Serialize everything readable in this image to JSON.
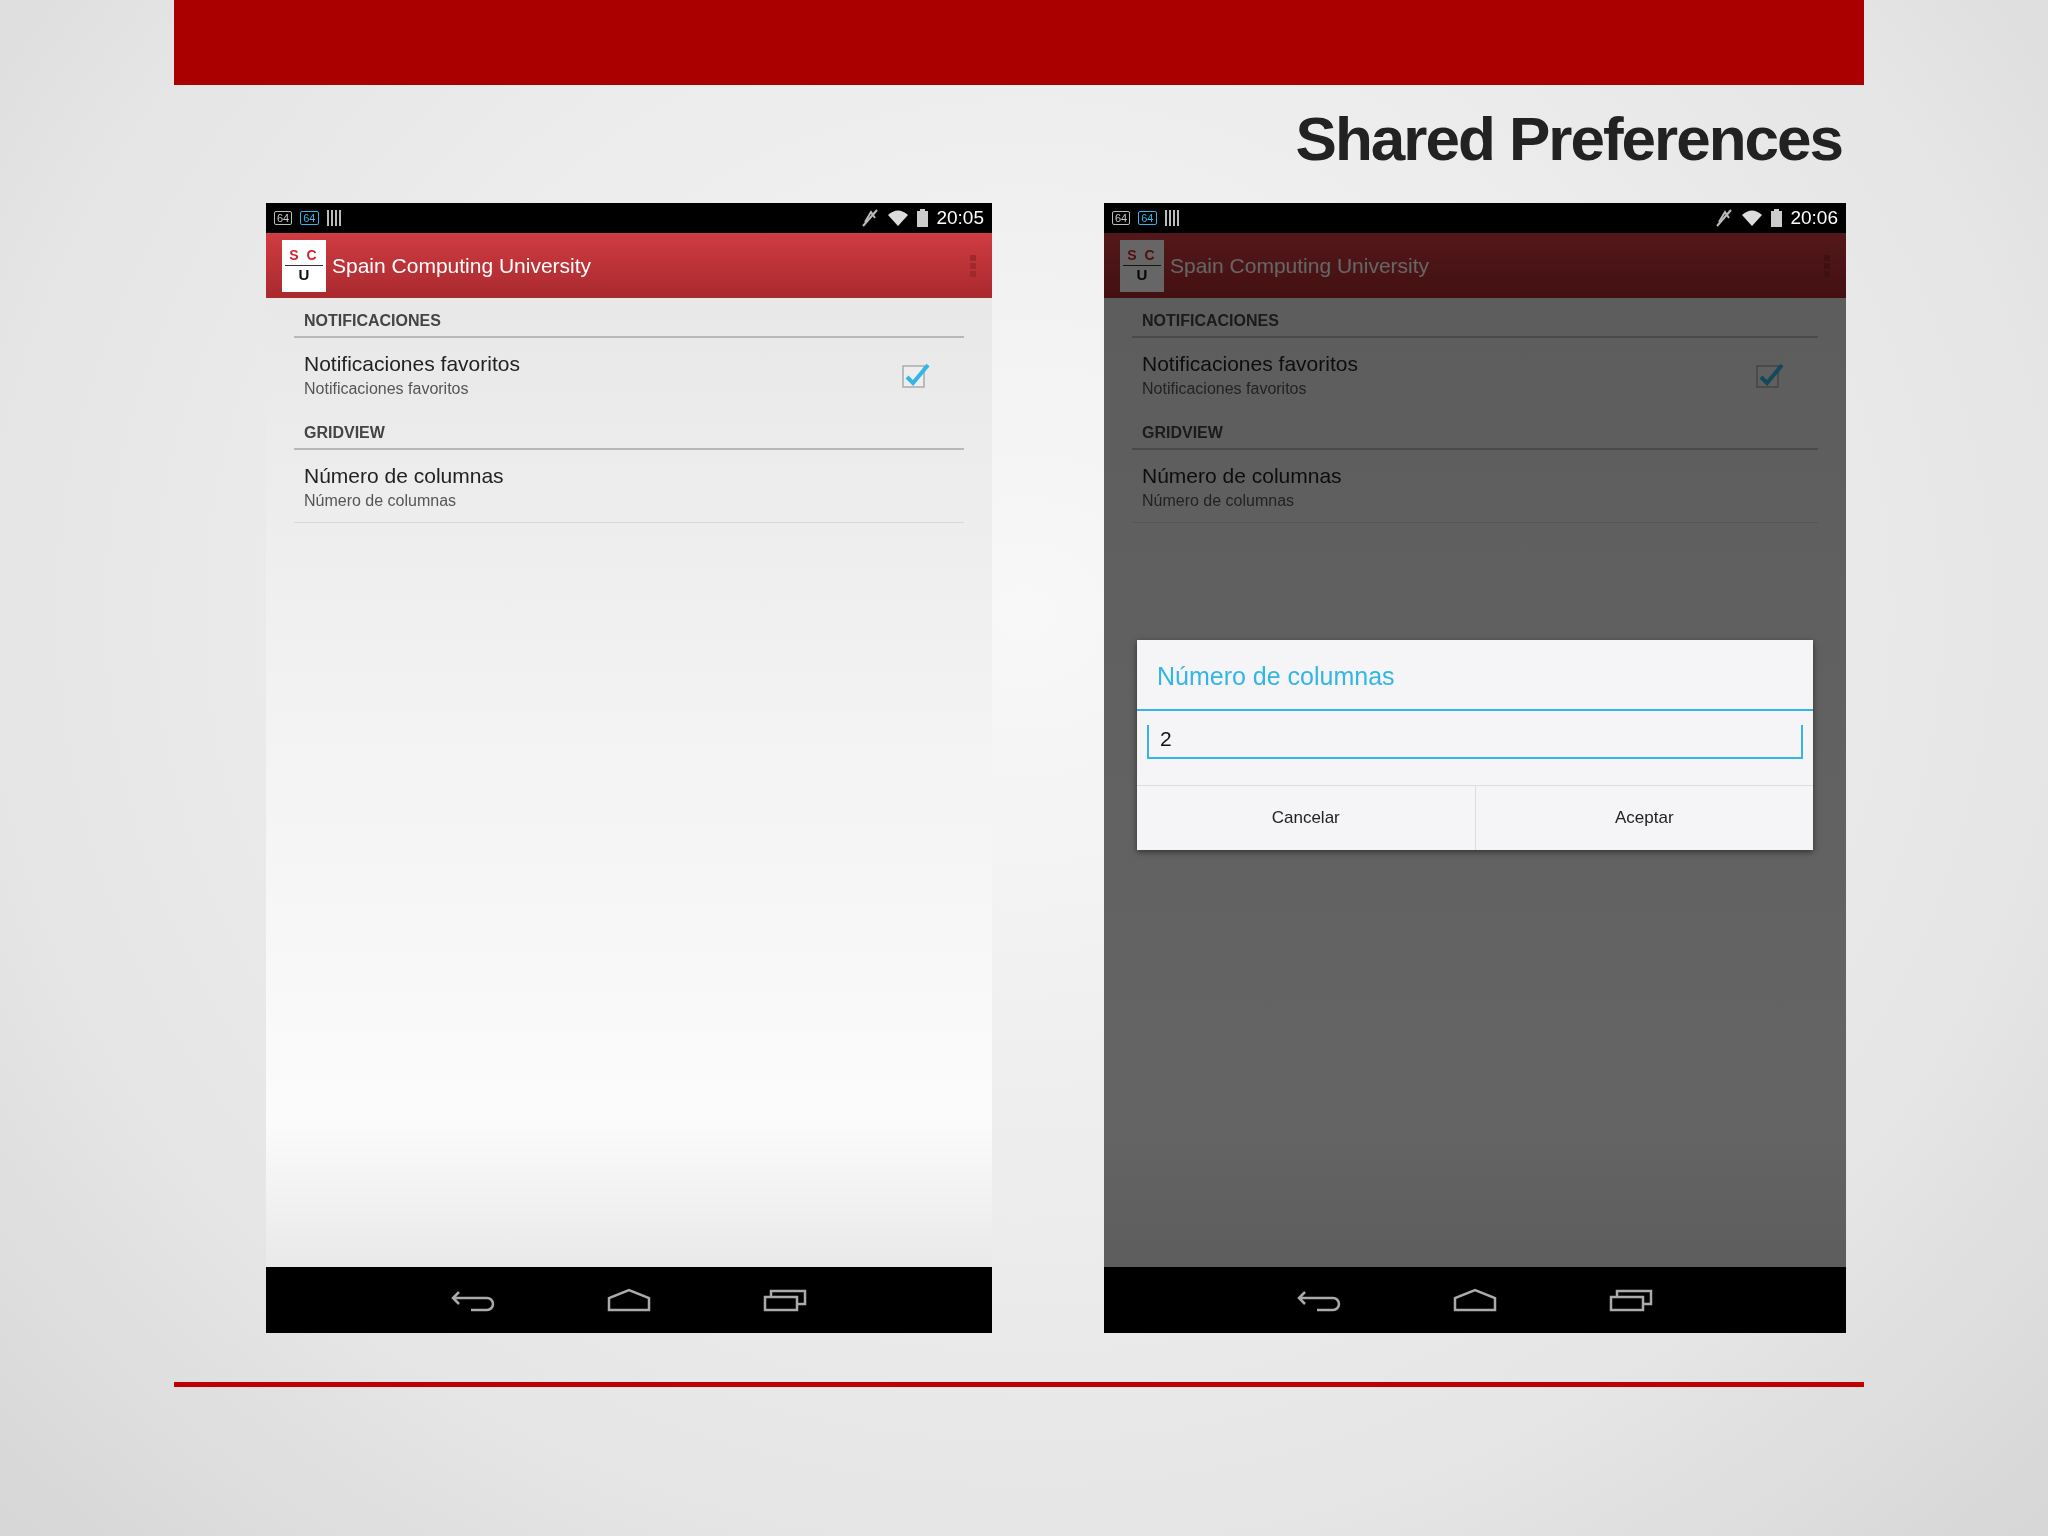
{
  "slide": {
    "title": "Shared Preferences"
  },
  "screens": [
    {
      "status": {
        "time": "20:05",
        "notif_1": "64",
        "notif_2": "64"
      },
      "app_bar": {
        "logo_top": "S C",
        "logo_bottom": "U",
        "title": "Spain Computing University"
      },
      "sections": [
        {
          "header": "NOTIFICACIONES",
          "items": [
            {
              "kind": "checkbox",
              "title": "Notificaciones favoritos",
              "summary": "Notificaciones favoritos",
              "checked": true
            }
          ]
        },
        {
          "header": "GRIDVIEW",
          "items": [
            {
              "kind": "plain",
              "title": "Número de columnas",
              "summary": "Número de columnas"
            }
          ]
        }
      ]
    },
    {
      "status": {
        "time": "20:06",
        "notif_1": "64",
        "notif_2": "64"
      },
      "app_bar": {
        "logo_top": "S C",
        "logo_bottom": "U",
        "title": "Spain Computing University"
      },
      "sections": [
        {
          "header": "NOTIFICACIONES",
          "items": [
            {
              "kind": "checkbox",
              "title": "Notificaciones favoritos",
              "summary": "Notificaciones favoritos",
              "checked": true
            }
          ]
        },
        {
          "header": "GRIDVIEW",
          "items": [
            {
              "kind": "plain",
              "title": "Número de columnas",
              "summary": "Número de columnas"
            }
          ]
        }
      ],
      "dialog": {
        "title": "Número de columnas",
        "value": "2",
        "buttons": [
          "Cancelar",
          "Aceptar"
        ]
      }
    }
  ]
}
